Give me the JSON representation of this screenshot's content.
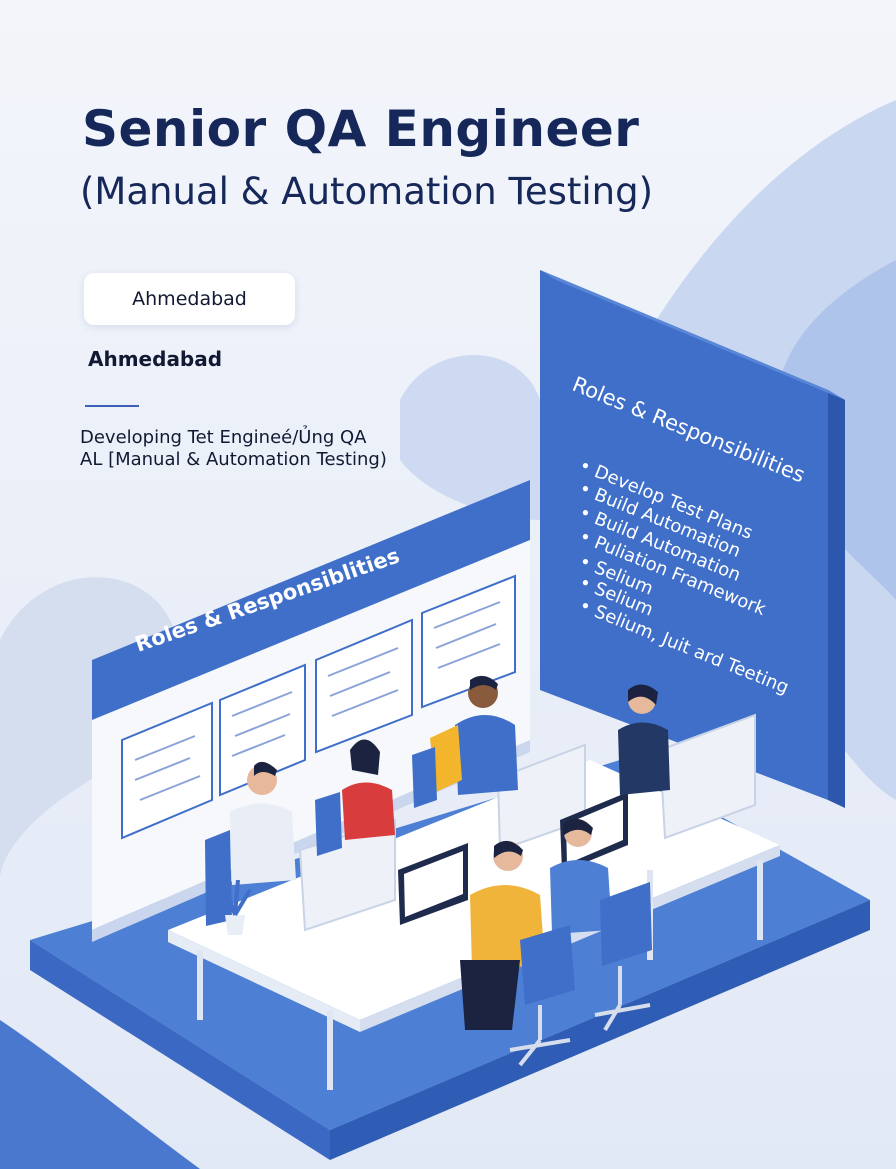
{
  "header": {
    "title": "Senior QA Engineer",
    "subtitle": "(Manual & Automation Testing)"
  },
  "location": {
    "chip_label": "Ahmedabad",
    "label": "Ahmedabad"
  },
  "description": {
    "text": "Developing Tet Engineé/Ủng QA AL [Manual & Automation Testing)"
  },
  "right_board": {
    "heading": "Roles & Responsibilities",
    "items": [
      "Develop Test Plans",
      "Build Automation",
      "Build Automation",
      "Puliation Framework",
      "Selium",
      "Selium",
      "Selium, Juit ard Teeting"
    ]
  },
  "left_board": {
    "heading": "Roles & Responsiblities"
  },
  "colors": {
    "accent": "#3f6fc9",
    "accent_dark": "#2f5cb5",
    "title": "#16285a",
    "background": "#eef2f9"
  }
}
